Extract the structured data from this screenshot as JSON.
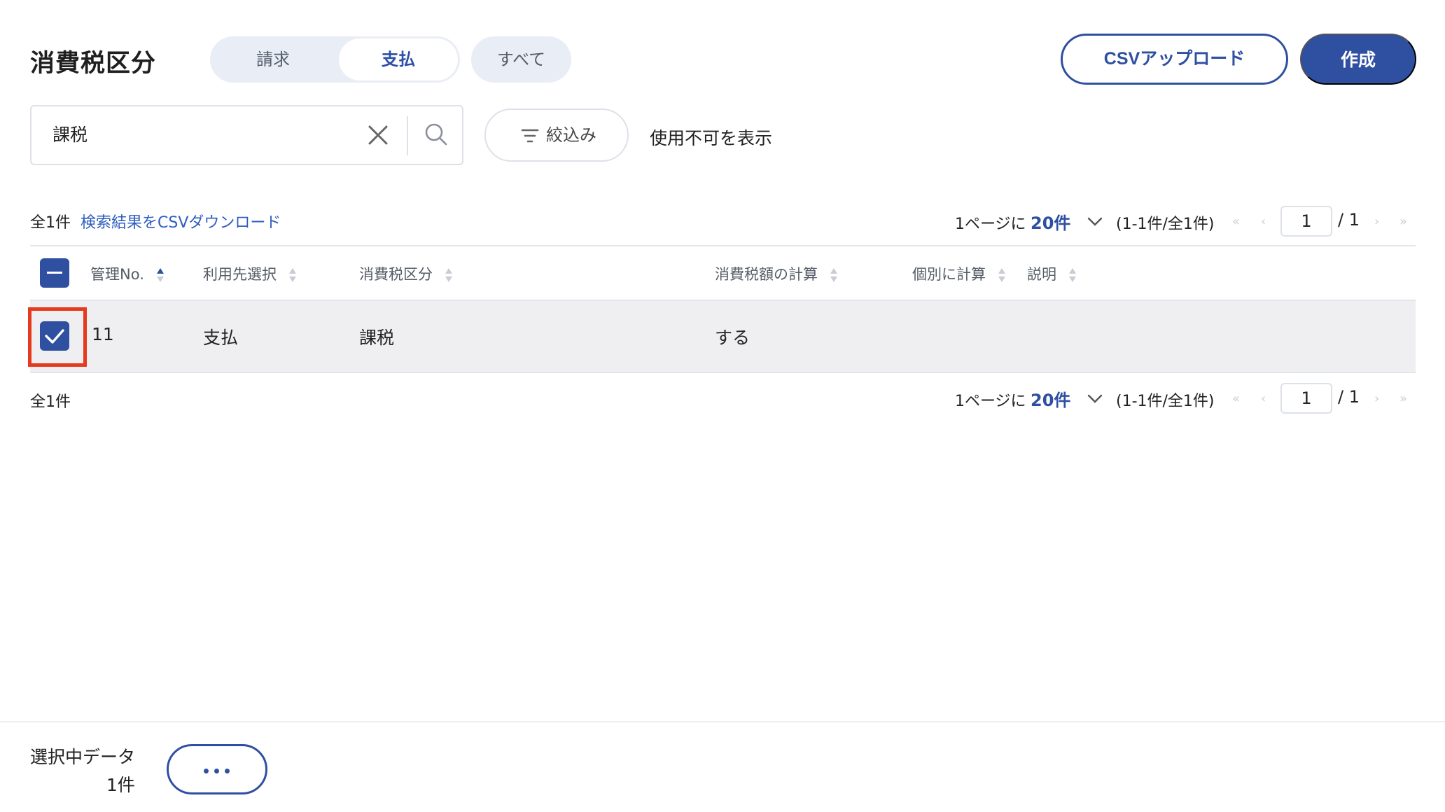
{
  "header": {
    "title": "消費税区分",
    "tabs": [
      {
        "label": "請求",
        "selected": false
      },
      {
        "label": "支払",
        "selected": true
      }
    ],
    "all_label": "すべて",
    "csv_upload_label": "CSVアップロード",
    "create_label": "作成"
  },
  "search": {
    "value": "課税",
    "filter_label": "絞込み",
    "show_disabled_label": "使用不可を表示"
  },
  "results": {
    "total_label": "全1件",
    "download_link": "検索結果をCSVダウンロード"
  },
  "pagination": {
    "per_page_prefix": "1ページに",
    "per_page_value": "20件",
    "range_text": "(1-1件/全1件)",
    "first": "«",
    "prev": "‹",
    "next": "›",
    "last": "»",
    "page_input": "1",
    "total_pages": "/ 1"
  },
  "table": {
    "columns": [
      "管理No.",
      "利用先選択",
      "消費税区分",
      "消費税額の計算",
      "個別に計算",
      "説明"
    ],
    "rows": [
      {
        "no": "11",
        "usage": "支払",
        "tax_category": "課税",
        "calc": "する",
        "individual": "",
        "description": ""
      }
    ]
  },
  "footer": {
    "selected_label": "選択中データ",
    "selected_count": "1件"
  },
  "colors": {
    "accent": "#2f4fa1",
    "link": "#2f5cc0",
    "highlight": "#e53a1e"
  }
}
